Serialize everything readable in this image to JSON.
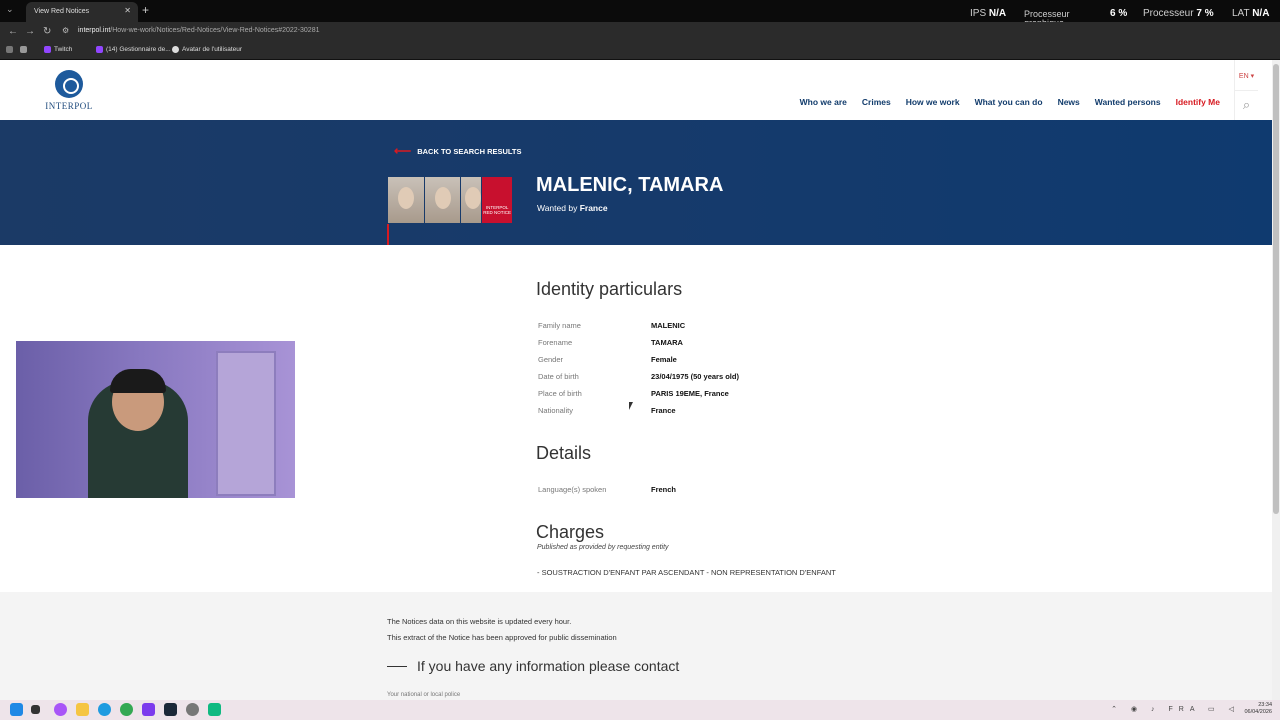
{
  "browser": {
    "tab_title": "View Red Notices",
    "url_domain": "interpol.int",
    "url_path": "/How-we-work/Notices/Red-Notices/View-Red-Notices#2022-30281",
    "bookmarks": [
      "Twitch",
      "(14) Gestionnaire de...",
      "Avatar de l'utilisateur"
    ]
  },
  "overlay": {
    "ips_label": "IPS",
    "ips_value": "N/A",
    "gpu_label_1": "Processeur",
    "gpu_label_2": "graphique",
    "gpu_value": "6 %",
    "cpu_label": "Processeur",
    "cpu_value": "7 %",
    "lat_label": "LAT",
    "lat_value": "N/A"
  },
  "site": {
    "logo_text": "INTERPOL",
    "nav": [
      "Who we are",
      "Crimes",
      "How we work",
      "What you can do",
      "News",
      "Wanted persons",
      "Identify Me"
    ],
    "lang": "EN ▾"
  },
  "hero": {
    "back_label": "BACK TO SEARCH RESULTS",
    "notice_label_1": "INTERPOL",
    "notice_label_2": "RED NOTICE",
    "name": "MALENIC, TAMARA",
    "wanted_prefix": "Wanted by",
    "wanted_by": "France"
  },
  "identity": {
    "heading": "Identity particulars",
    "rows": [
      {
        "label": "Family name",
        "value": "MALENIC"
      },
      {
        "label": "Forename",
        "value": "TAMARA"
      },
      {
        "label": "Gender",
        "value": "Female"
      },
      {
        "label": "Date of birth",
        "value": "23/04/1975 (50 years old)"
      },
      {
        "label": "Place of birth",
        "value": "PARIS 19EME, France"
      },
      {
        "label": "Nationality",
        "value": "France"
      }
    ]
  },
  "details": {
    "heading": "Details",
    "rows": [
      {
        "label": "Language(s) spoken",
        "value": "French"
      }
    ]
  },
  "charges": {
    "heading": "Charges",
    "subtitle": "Published as provided by requesting entity",
    "text": "- SOUSTRACTION D'ENFANT PAR ASCENDANT - NON REPRESENTATION D'ENFANT"
  },
  "footer": {
    "line1": "The Notices data on this website is updated every hour.",
    "line2": "This extract of the Notice has been approved for public dissemination",
    "contact": "If you have any information please contact",
    "cut_text": "Your national or local police"
  },
  "taskbar": {
    "lang": "FRA",
    "time": "23:34",
    "date": "06/04/2026"
  }
}
